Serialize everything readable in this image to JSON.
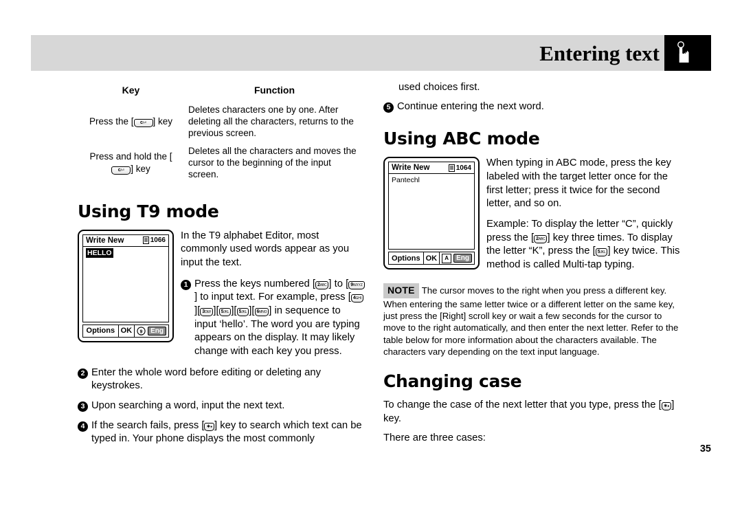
{
  "header": {
    "title": "Entering text",
    "icon": "hand-pointing-icon"
  },
  "page_number": "35",
  "left_column": {
    "table": {
      "columns": [
        "Key",
        "Function"
      ],
      "rows": [
        {
          "key_prefix": "Press the [",
          "key_glyph": "c-back-key",
          "key_suffix": "] key",
          "function": "Deletes characters one by one. After deleting all the characters, returns to the previous screen."
        },
        {
          "key_prefix": "Press and hold the [",
          "key_glyph": "c-back-key",
          "key_suffix": "] key",
          "function": "Deletes all the characters and moves the cursor to the beginning of the input screen."
        }
      ]
    },
    "heading": "Using T9 mode",
    "phone": {
      "title": "Write New",
      "counter": "1066",
      "counter_icon": "message-icon",
      "content": "HELLO",
      "softkey_left": "Options",
      "softkey_center": "OK",
      "mode_icon": "t9-icon",
      "language": "Eng"
    },
    "intro": "In the T9 alphabet Editor, most commonly used words appear as you input the text.",
    "steps": [
      {
        "num": "1",
        "parts": [
          {
            "t": "text",
            "v": "Press the keys numbered ["
          },
          {
            "t": "key",
            "d": "2",
            "l": "ABC"
          },
          {
            "t": "text",
            "v": "] to ["
          },
          {
            "t": "key",
            "d": "9",
            "l": "WXYZ"
          },
          {
            "t": "text",
            "v": "] to input text. For example, press ["
          },
          {
            "t": "key",
            "d": "4",
            "l": "GHI"
          },
          {
            "t": "text",
            "v": "]["
          },
          {
            "t": "key",
            "d": "3",
            "l": "DEF"
          },
          {
            "t": "text",
            "v": "]["
          },
          {
            "t": "key",
            "d": "5",
            "l": "JKL"
          },
          {
            "t": "text",
            "v": "]["
          },
          {
            "t": "key",
            "d": "5",
            "l": "JKL"
          },
          {
            "t": "text",
            "v": "]["
          },
          {
            "t": "key",
            "d": "6",
            "l": "MNO"
          },
          {
            "t": "text",
            "v": "] in sequence to input ‘hello’. The word you are typing appears on the display. It may likely change with each key you press."
          }
        ]
      },
      {
        "num": "2",
        "parts": [
          {
            "t": "text",
            "v": "Enter the whole word before editing or deleting any keystrokes."
          }
        ]
      },
      {
        "num": "3",
        "parts": [
          {
            "t": "text",
            "v": "Upon searching a word, input the next text."
          }
        ]
      },
      {
        "num": "4",
        "parts": [
          {
            "t": "text",
            "v": "If the search fails, press ["
          },
          {
            "t": "key",
            "d": "∗",
            "l": "●"
          },
          {
            "t": "text",
            "v": "] key to search which text can be typed in. Your phone displays the most commonly"
          }
        ]
      }
    ]
  },
  "right_column": {
    "continuation": "used choices first.",
    "step5": {
      "num": "5",
      "text": "Continue entering the next word."
    },
    "abc_heading": "Using ABC mode",
    "phone": {
      "title": "Write New",
      "counter": "1064",
      "counter_icon": "message-icon",
      "content": "Pantechl",
      "softkey_left": "Options",
      "softkey_center": "OK",
      "mode_icon": "abc-icon",
      "language": "Eng"
    },
    "abc_para1": "When typing in ABC mode, press the key labeled with the target letter once for the first letter; press it twice for the second letter, and so on.",
    "abc_para2_parts": [
      {
        "t": "text",
        "v": "Example: To display the letter “C”, quickly press the ["
      },
      {
        "t": "key",
        "d": "2",
        "l": "ABC"
      },
      {
        "t": "text",
        "v": "] key three times. To display the letter “K”, press the ["
      },
      {
        "t": "key",
        "d": "5",
        "l": "JKL"
      },
      {
        "t": "text",
        "v": "] key twice. This method is called Multi-tap typing."
      }
    ],
    "note": {
      "tag": "NOTE",
      "text": "The cursor moves to the right when you press a different key. When entering the same letter twice or a different letter on the same key, just press the [Right] scroll key or wait a few seconds for the cursor to move to the right automatically, and then enter the next letter. Refer to the table below for more information about the characters available. The characters vary depending on the text input language."
    },
    "case_heading": "Changing case",
    "case_para_parts": [
      {
        "t": "text",
        "v": "To change the case of the next letter that you type, press the ["
      },
      {
        "t": "key",
        "d": "∗",
        "l": "●"
      },
      {
        "t": "text",
        "v": "] key."
      }
    ],
    "case_tail": "There are three cases:"
  },
  "colors": {
    "header_band": "#d7d7d7",
    "header_iconbox": "#000000",
    "note_tag": "#c9c9c9",
    "eng_badge": "#8c8c8c"
  }
}
